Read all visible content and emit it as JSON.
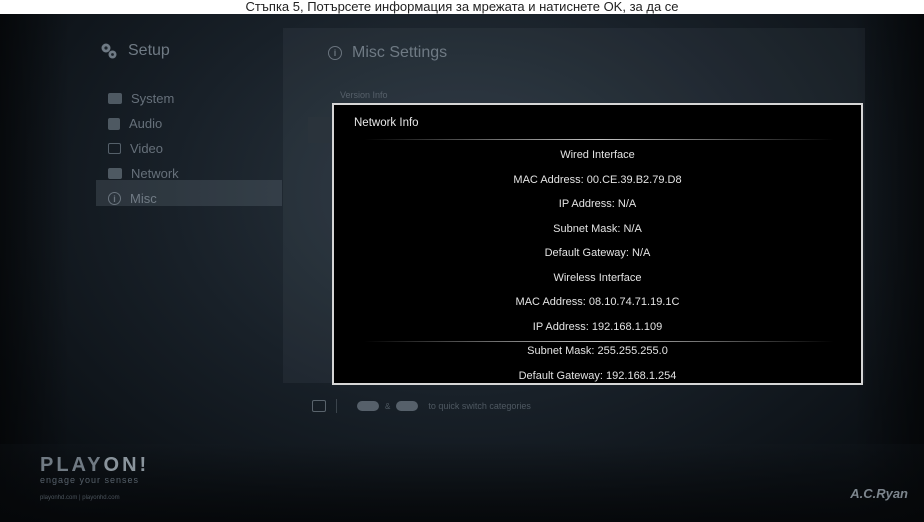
{
  "caption": "Стъпка 5, Потърсете информация за мрежата и натиснете OK, за да се",
  "setup": {
    "title": "Setup"
  },
  "menu": {
    "items": [
      {
        "label": "System",
        "icon": "system-icon"
      },
      {
        "label": "Audio",
        "icon": "audio-icon"
      },
      {
        "label": "Video",
        "icon": "video-icon"
      },
      {
        "label": "Network",
        "icon": "network-icon"
      },
      {
        "label": "Misc",
        "icon": "info-icon"
      }
    ],
    "selected": "Misc"
  },
  "misc": {
    "title": "Misc Settings",
    "version_label": "Version Info"
  },
  "dialog": {
    "title": "Network Info",
    "lines": [
      "Wired Interface",
      "MAC Address: 00.CE.39.B2.79.D8",
      "IP Address: N/A",
      "Subnet Mask: N/A",
      "Default Gateway: N/A",
      "Wireless Interface",
      "MAC Address: 08.10.74.71.19.1C",
      "IP Address: 192.168.1.109",
      "Subnet Mask: 255.255.255.0",
      "Default Gateway: 192.168.1.254"
    ]
  },
  "footer": {
    "hint": "to quick switch categories"
  },
  "brand": {
    "logo_prefix": "PLAY",
    "logo_suffix": "ON!",
    "tagline": "engage your senses",
    "links": "playonhd.com | playonhd.com",
    "maker": "A.C.Ryan"
  }
}
